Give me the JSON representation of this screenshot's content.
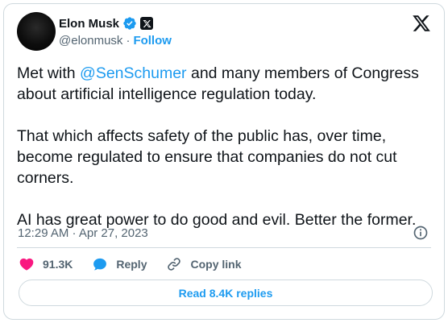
{
  "author": {
    "display_name": "Elon Musk",
    "handle": "@elonmusk",
    "separator": "·",
    "follow_label": "Follow",
    "verified_icon": "verified-badge-icon",
    "affiliation_icon": "x-affiliation-icon"
  },
  "tweet": {
    "line1_pre": "Met with ",
    "mention": "@SenSchumer",
    "line1_post": " and many members of Congress about artificial intelligence regulation today.",
    "paragraph2": "That which affects safety of the public has, over time, become regulated to ensure that companies do not cut corners.",
    "paragraph3": "AI has great power to do good and evil. Better the former.",
    "timestamp": "12:29 AM · Apr 27, 2023"
  },
  "actions": {
    "likes": "91.3K",
    "reply_label": "Reply",
    "copy_link_label": "Copy link",
    "read_replies_label": "Read 8.4K replies"
  },
  "colors": {
    "accent": "#1d9bf0",
    "like": "#f91880",
    "text": "#0f1419",
    "muted": "#536471",
    "border": "#cfd9de"
  }
}
